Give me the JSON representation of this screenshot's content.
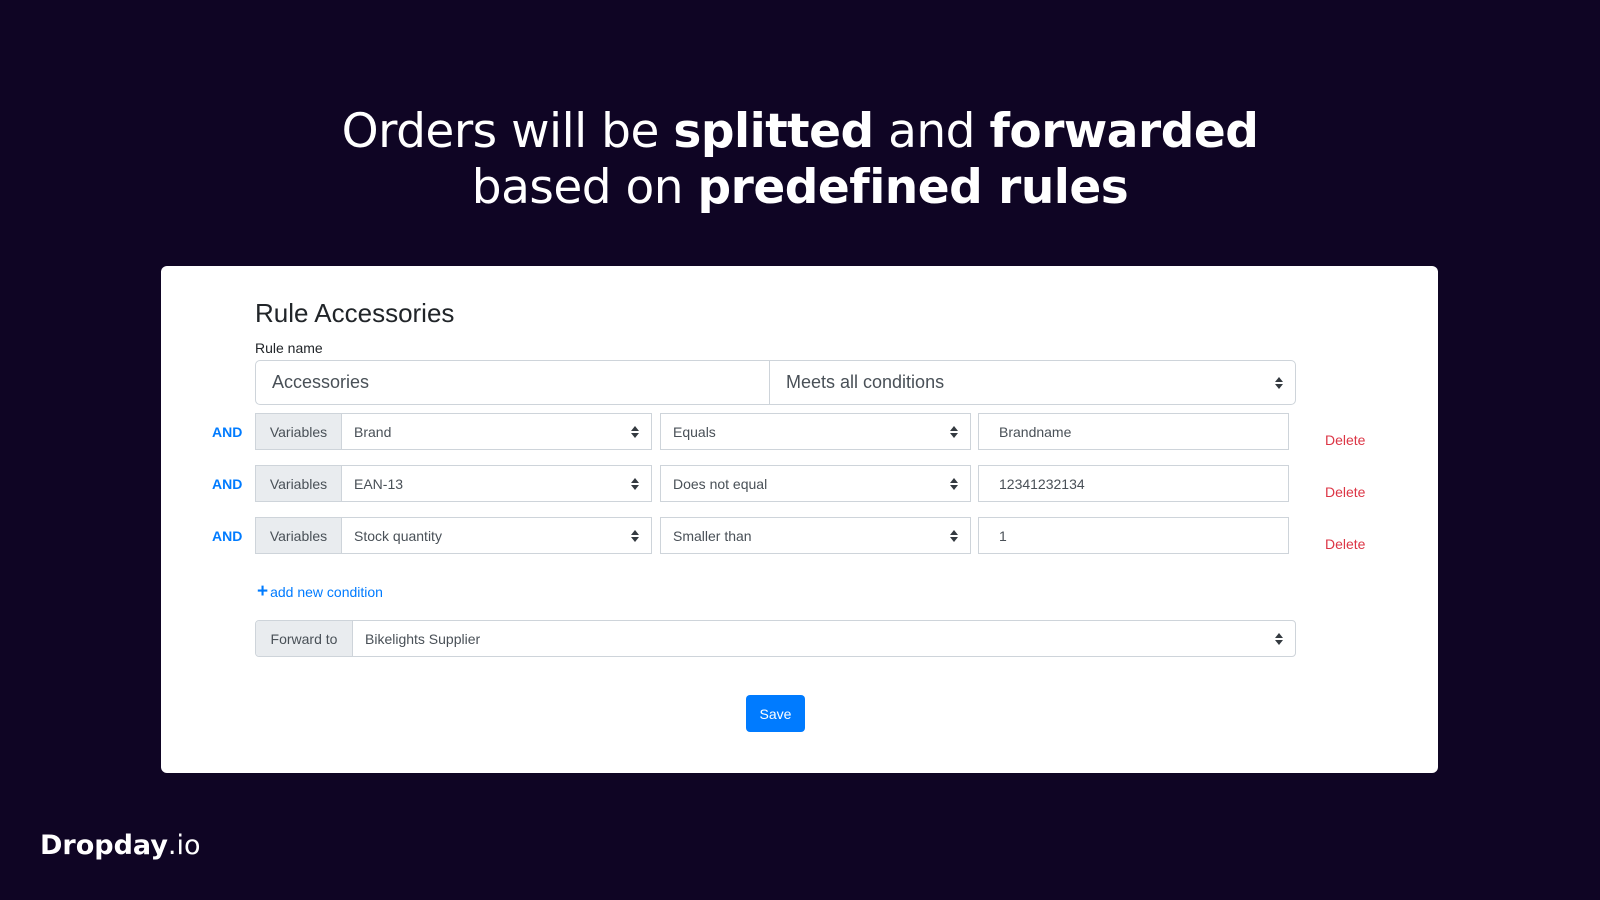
{
  "headline": {
    "line1": [
      {
        "text": "Orders will be ",
        "bold": false
      },
      {
        "text": "splitted",
        "bold": true
      },
      {
        "text": " and ",
        "bold": false
      },
      {
        "text": "forwarded",
        "bold": true
      }
    ],
    "line2": [
      {
        "text": "based on ",
        "bold": false
      },
      {
        "text": "predefined rules",
        "bold": true
      }
    ]
  },
  "form": {
    "title": "Rule Accessories",
    "rule_name_label": "Rule name",
    "rule_name_value": "Accessories",
    "match_mode": "Meets all conditions",
    "conditions": [
      {
        "connector": "AND",
        "prefix": "Variables",
        "variable": "Brand",
        "operator": "Equals",
        "value": "Brandname",
        "delete_label": "Delete"
      },
      {
        "connector": "AND",
        "prefix": "Variables",
        "variable": "EAN-13",
        "operator": "Does not equal",
        "value": "12341232134",
        "delete_label": "Delete"
      },
      {
        "connector": "AND",
        "prefix": "Variables",
        "variable": "Stock quantity",
        "operator": "Smaller than",
        "value": "1",
        "delete_label": "Delete"
      }
    ],
    "add_condition_label": "add new condition",
    "forward_prefix": "Forward to",
    "forward_value": "Bikelights Supplier",
    "save_label": "Save"
  },
  "brand": {
    "name_bold": "Dropday",
    "name_suffix": ".io"
  },
  "colors": {
    "background": "#0f0524",
    "accent": "#007bff",
    "danger": "#dc3545"
  }
}
